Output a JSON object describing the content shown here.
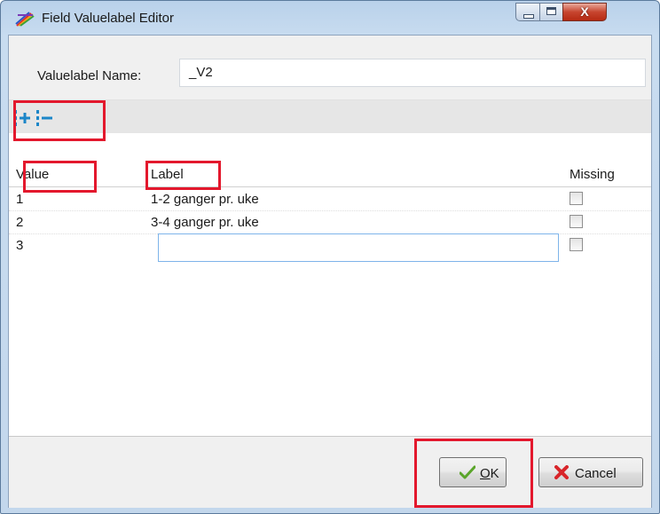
{
  "window": {
    "title": "Field Valuelabel Editor",
    "icons": {
      "app": "rainbow-pen-icon",
      "minimize": "minimize-icon",
      "maximize": "maximize-icon",
      "close": "close-icon"
    },
    "close_glyph": "X"
  },
  "form": {
    "name_label": "Valuelabel Name:",
    "name_value": "_V2"
  },
  "toolbar": {
    "add_icon": "add-row-icon",
    "remove_icon": "remove-row-icon"
  },
  "grid": {
    "columns": {
      "value": "Value",
      "label": "Label",
      "missing": "Missing"
    },
    "rows": [
      {
        "value": "1",
        "label": "1-2 ganger pr. uke",
        "missing": false
      },
      {
        "value": "2",
        "label": "3-4 ganger pr. uke",
        "missing": false
      },
      {
        "value": "3",
        "label": "",
        "missing": false
      }
    ]
  },
  "buttons": {
    "ok": {
      "label": "OK",
      "mnemonic": "O",
      "rest": "K",
      "icon": "checkmark-icon"
    },
    "cancel": {
      "label": "Cancel",
      "icon": "red-x-icon"
    }
  },
  "colors": {
    "highlight": "#e3182d",
    "toolbar_icon": "#1c86c8",
    "title_gradient": "#c8dcf0"
  }
}
